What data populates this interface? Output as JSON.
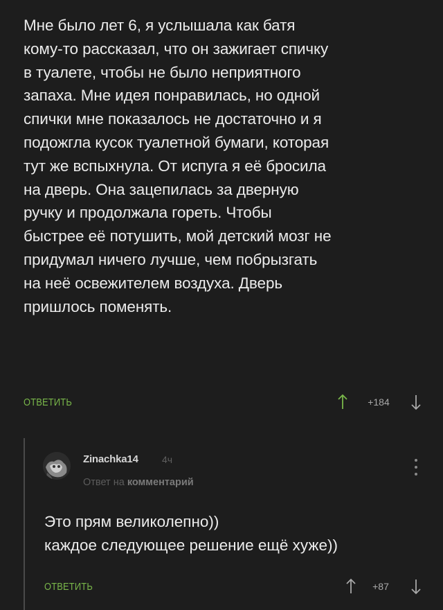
{
  "comment": {
    "lines": [
      "Мне было лет 6, я услышала как батя",
      "кому-то рассказал, что он зажигает спичку",
      "в туалете, чтобы не было неприятного",
      "запаха. Мне идея понравилась, но одной",
      "спички мне показалось не достаточно и я",
      "подожгла кусок туалетной бумаги, которая",
      "тут же вспыхнула. От испуга я её бросила",
      "на дверь. Она зацепилась за дверную",
      "ручку и продолжала гореть. Чтобы",
      "быстрее её потушить, мой детский мозг не",
      "придумал ничего лучше, чем побрызгать",
      "на неё освежителем воздуха. Дверь",
      "пришлось поменять."
    ],
    "reply_label": "ОТВЕТИТЬ",
    "rating": "+184"
  },
  "reply": {
    "username": "Zinachka14",
    "time": "4ч",
    "reply_to_prefix": "Ответ на",
    "reply_to_link": "комментарий",
    "lines": [
      "Это прям великолепно))",
      "каждое следующее решение ещё хуже))"
    ],
    "reply_label": "ОТВЕТИТЬ",
    "rating": "+87"
  },
  "icons": {
    "upvote": "arrow-up-icon",
    "downvote": "arrow-down-icon",
    "more": "vertical-dots-icon"
  },
  "colors": {
    "background": "#1d1d1d",
    "accent": "#79b74a",
    "text": "#ececec",
    "muted": "#5c5c5c"
  }
}
